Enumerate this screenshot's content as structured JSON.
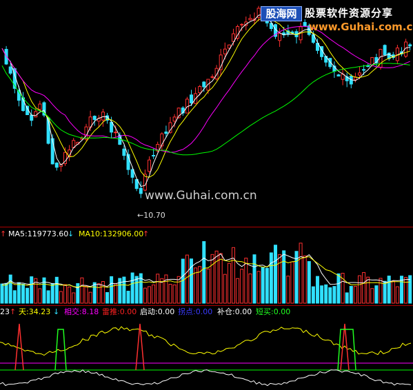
{
  "watermark": {
    "badge": "股海网",
    "slogan": "股票软件资源分享",
    "url_top": "www.Guhai.com.cn",
    "url_mid": "www.Guhai.com.cn"
  },
  "price_panel": {
    "low_label": "←10.70"
  },
  "volume_panel": {
    "ma5_label": "MA5:119773.60",
    "ma5_arrow": "↓",
    "ma10_label": "MA10:132906.00",
    "ma10_arrow": "↑",
    "colors": {
      "ma5": "#ffffff",
      "ma10": "#ffff00"
    }
  },
  "indicator_panel": {
    "first_value": "23",
    "items": [
      {
        "label": "天:34.23",
        "arrow": "↓",
        "color": "#ffff00"
      },
      {
        "label": "相交:8.18",
        "color": "#ff00ff"
      },
      {
        "label": "雷推:0.00",
        "color": "#ff2020"
      },
      {
        "label": "启动:0.00",
        "color": "#ffffff"
      },
      {
        "label": "拐点:0.00",
        "color": "#3a3aff"
      },
      {
        "label": "补仓:0.00",
        "color": "#ffffff"
      },
      {
        "label": "短买:0.00",
        "color": "#20ff20"
      }
    ]
  },
  "colors": {
    "up": "#ff3030",
    "down": "#30e0ff",
    "ma_short": "#ffffff",
    "ma_mid": "#ffff00",
    "ma_long": "#ff00ff",
    "ma_xlong": "#00ff00",
    "divider": "#b00000"
  }
}
